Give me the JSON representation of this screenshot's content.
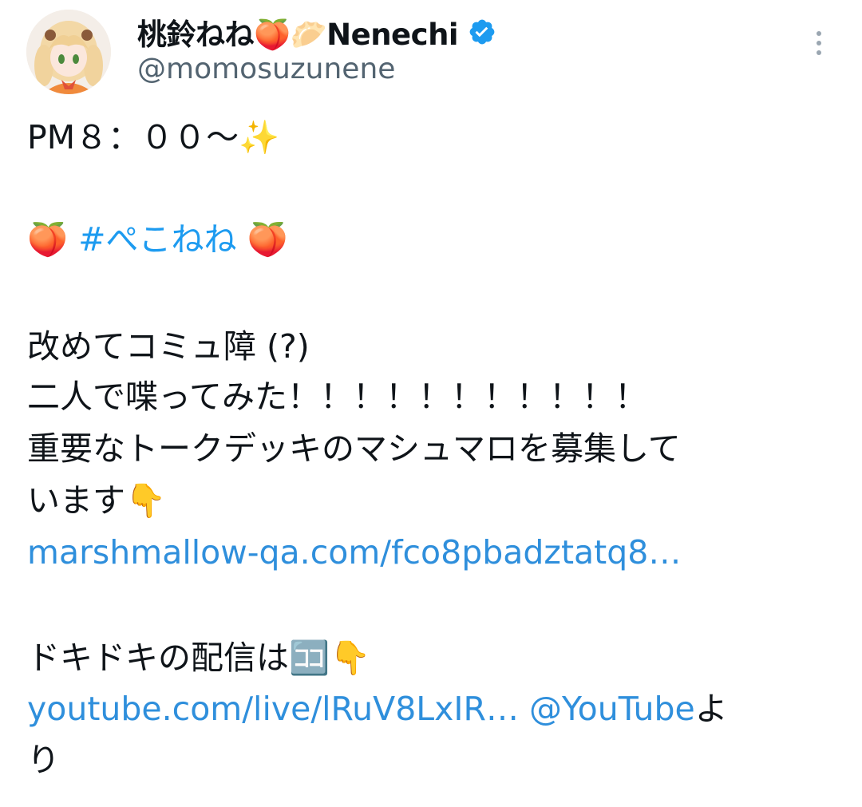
{
  "author": {
    "display_name": "桃鈴ねね🍑🥟Nenechi",
    "handle": "@momosuzunene",
    "verified": true
  },
  "tweet": {
    "time_line": "PM８：００～✨",
    "hashtag_line": {
      "lead_emoji": "🍑",
      "hashtag": "#ぺこねね",
      "trail_emoji": "🍑"
    },
    "line1": "改めてコミュ障 (?)",
    "line2": "二人で喋ってみた！！！！！！！！！！！",
    "line3": "重要なトークデッキのマシュマロを募集して",
    "line4": "います👇",
    "marshmallow_link": "marshmallow-qa.com/fco8pbadztatq8…",
    "line5": "ドキドキの配信は🈁👇",
    "youtube_link": "youtube.com/live/lRuV8LxIR…",
    "youtube_mention": "@YouTube",
    "youtube_suffix": "よ",
    "line6": "り"
  },
  "icons": {
    "verified": "verified-badge-icon",
    "more": "more-vertical-icon",
    "peach": "peach-emoji",
    "sparkles": "sparkles-emoji",
    "pointing_down": "pointing-down-emoji",
    "koko": "koko-emoji"
  },
  "colors": {
    "text": "#0f1419",
    "secondary": "#536471",
    "link": "#1d9bf0",
    "verified": "#1d9bf0"
  }
}
